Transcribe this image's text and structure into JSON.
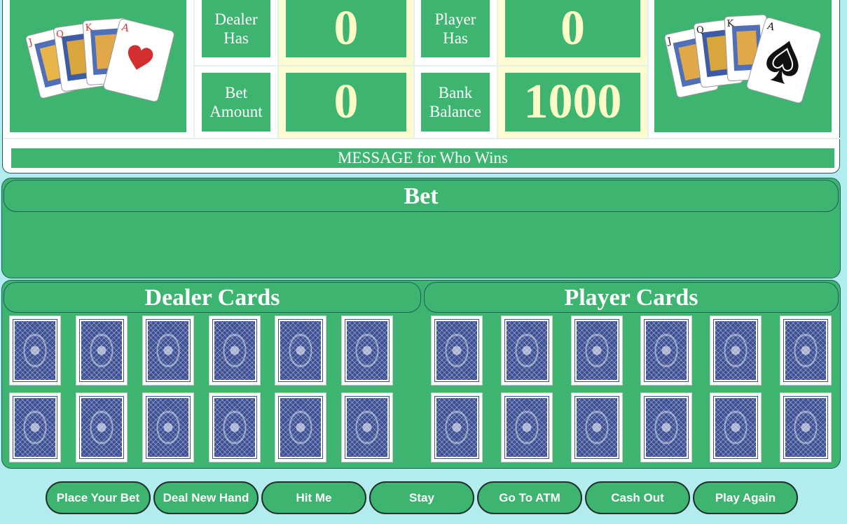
{
  "stats": {
    "dealer_has_label": "Dealer\nHas",
    "dealer_has_value": "0",
    "player_has_label": "Player\nHas",
    "player_has_value": "0",
    "bet_amount_label": "Bet\nAmount",
    "bet_amount_value": "0",
    "bank_balance_label": "Bank\nBalance",
    "bank_balance_value": "1000"
  },
  "message": "MESSAGE for Who Wins",
  "bet_section": {
    "title": "Bet"
  },
  "dealer_section": {
    "title": "Dealer Cards"
  },
  "player_section": {
    "title": "Player Cards"
  },
  "buttons": {
    "place_bet": "Place Your Bet",
    "deal_new_hand": "Deal New Hand",
    "hit_me": "Hit Me",
    "stay": "Stay",
    "go_to_atm": "Go To ATM",
    "cash_out": "Cash Out",
    "play_again": "Play Again"
  },
  "decor": {
    "left_hand": [
      "J-hearts",
      "Q-hearts",
      "K-hearts",
      "A-hearts"
    ],
    "right_hand": [
      "J-spades",
      "Q-spades",
      "K-spades",
      "A-spades"
    ],
    "left_hand_icon": "heart-suit-icon",
    "right_hand_icon": "spade-suit-icon",
    "card_back_icon": "card-back-pattern"
  },
  "colors": {
    "page_bg": "#b3ecef",
    "felt_green": "#3db46f",
    "value_cream": "#fdfbc6",
    "border_dark": "#1f5f58",
    "card_back_blue": "#3d4f94",
    "suit_red": "#d32f2f"
  }
}
